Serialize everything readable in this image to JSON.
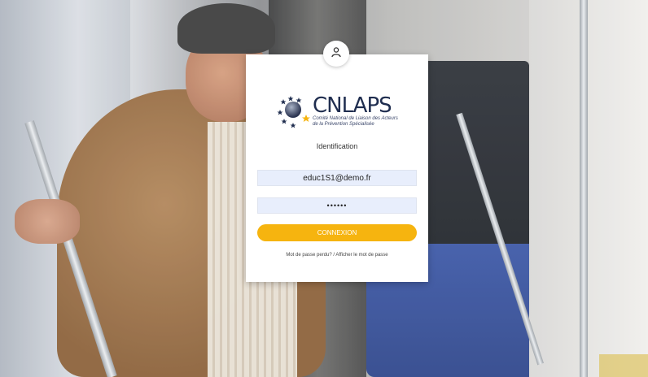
{
  "logo": {
    "name": "CNLAPS",
    "subtitle": "Comité National de Liaison des Acteurs de la Prévention Spécialisée"
  },
  "form": {
    "heading": "Identification",
    "email_value": "educ1S1@demo.fr",
    "password_value": "••••••",
    "submit_label": "CONNEXION"
  },
  "links": {
    "forgot_password": "Mot de passe perdu?",
    "separator": " / ",
    "show_password": "Afficher le mot de passe"
  },
  "icons": {
    "avatar": "user-icon"
  },
  "colors": {
    "accent": "#f6b40f",
    "input_bg": "#e8eefc",
    "brand_navy": "#1f2d4f"
  }
}
